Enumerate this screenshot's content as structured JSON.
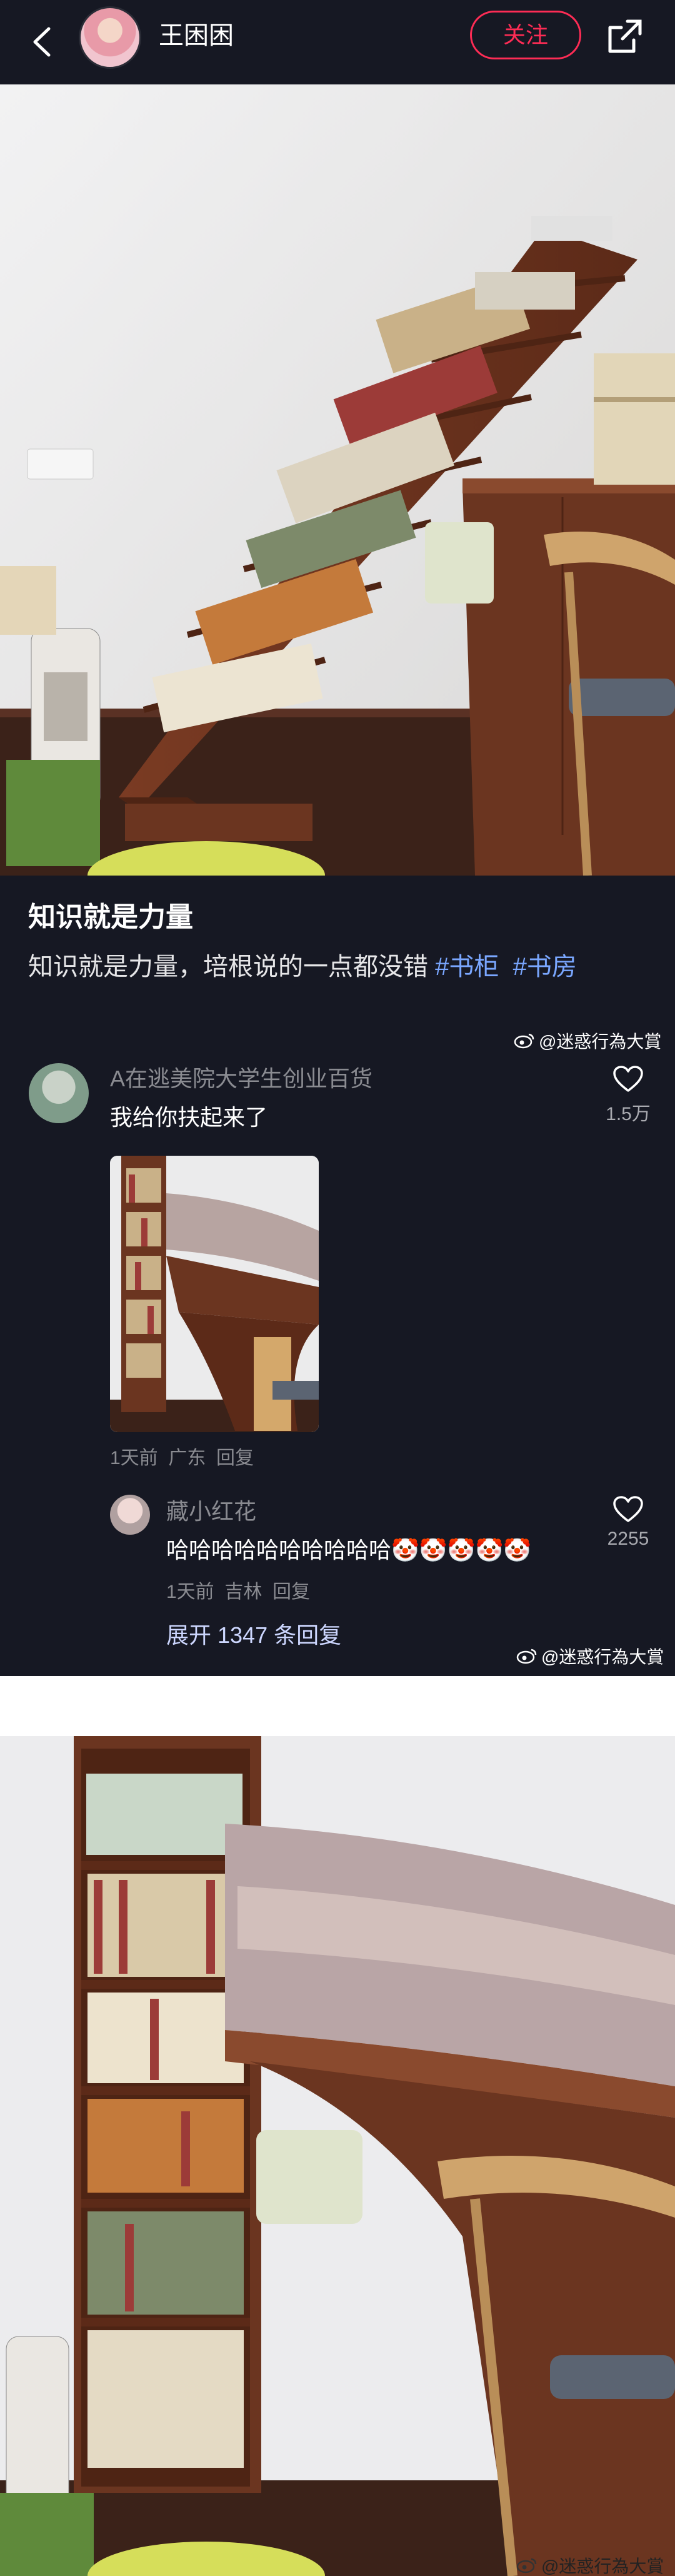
{
  "header": {
    "username": "王困困",
    "follow_label": "关注"
  },
  "post": {
    "title": "知识就是力量",
    "body_text": "知识就是力量，培根说的一点都没错 ",
    "tags": [
      "#书柜",
      "#书房"
    ]
  },
  "watermark": "@迷惑行為大賞",
  "comment": {
    "author": "A在逃美院大学生创业百货",
    "text": "我给你扶起来了",
    "likes": "1.5万",
    "meta_time": "1天前",
    "meta_location": "广东",
    "meta_reply": "回复"
  },
  "sub_reply": {
    "author": "藏小红花",
    "text": "哈哈哈哈哈哈哈哈哈哈",
    "emoji": "🤡🤡🤡🤡🤡",
    "likes": "2255",
    "meta_time": "1天前",
    "meta_location": "吉林",
    "meta_reply": "回复"
  },
  "expand_replies": "展开 1347 条回复",
  "icons": {
    "back": "back-arrow-icon",
    "share": "share-icon",
    "like": "heart-icon",
    "weibo": "weibo-icon"
  },
  "colors": {
    "bg_dark": "#161823",
    "accent": "#fe2c55",
    "tag": "#7aa7ff"
  }
}
